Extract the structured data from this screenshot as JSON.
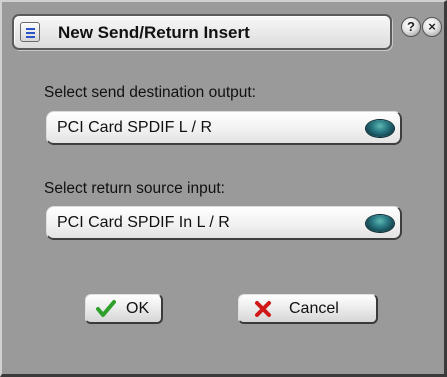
{
  "dialog": {
    "title": "New Send/Return Insert",
    "help_label": "?",
    "close_label": "×"
  },
  "send": {
    "label": "Select send destination output:",
    "selected": "PCI Card SPDIF L / R"
  },
  "return": {
    "label": "Select return source input:",
    "selected": "PCI Card SPDIF In L / R"
  },
  "buttons": {
    "ok_label": "OK",
    "cancel_label": "Cancel"
  },
  "icons": {
    "menu": "menu-icon",
    "help": "help-icon",
    "close": "close-icon",
    "ok": "checkmark-icon",
    "cancel": "x-icon"
  },
  "colors": {
    "checkmark": "#2fa12a",
    "cancel_x": "#d01818",
    "knob": "#1a5c66"
  }
}
